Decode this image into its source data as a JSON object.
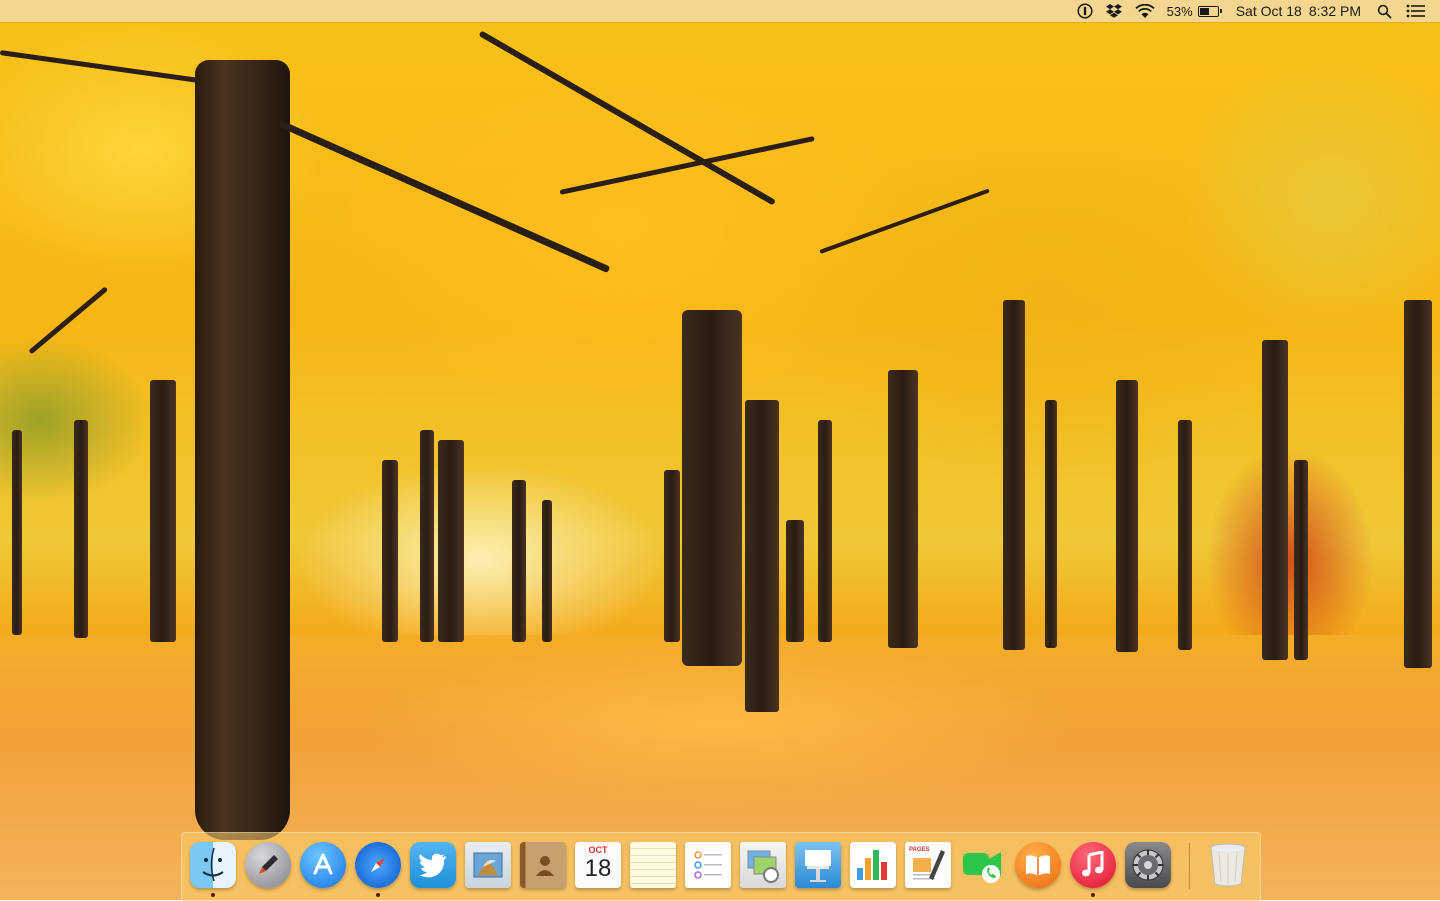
{
  "menubar": {
    "battery_percent": "53%",
    "battery_level": 0.53,
    "date": "Sat Oct 18",
    "time": "8:32 PM",
    "icons": [
      "onepassword-icon",
      "dropbox-icon",
      "wifi-icon",
      "battery-icon",
      "spotlight-icon",
      "notification-center-icon"
    ]
  },
  "dock": {
    "apps": [
      {
        "name": "Finder",
        "icon": "finder-icon",
        "running": true
      },
      {
        "name": "Launchpad",
        "icon": "launchpad-icon",
        "running": false
      },
      {
        "name": "App Store",
        "icon": "app-store-icon",
        "running": false
      },
      {
        "name": "Safari",
        "icon": "safari-icon",
        "running": true
      },
      {
        "name": "Twitter",
        "icon": "twitter-icon",
        "running": false
      },
      {
        "name": "Mail",
        "icon": "mail-icon",
        "running": false
      },
      {
        "name": "Contacts",
        "icon": "contacts-icon",
        "running": false
      },
      {
        "name": "Calendar",
        "icon": "calendar-icon",
        "running": false
      },
      {
        "name": "Notes",
        "icon": "notes-icon",
        "running": false
      },
      {
        "name": "Reminders",
        "icon": "reminders-icon",
        "running": false
      },
      {
        "name": "Preview",
        "icon": "preview-icon",
        "running": false
      },
      {
        "name": "Keynote",
        "icon": "keynote-icon",
        "running": false
      },
      {
        "name": "Numbers",
        "icon": "numbers-icon",
        "running": false
      },
      {
        "name": "Pages",
        "icon": "pages-icon",
        "running": false
      },
      {
        "name": "FaceTime",
        "icon": "facetime-icon",
        "running": false
      },
      {
        "name": "iBooks",
        "icon": "ibooks-icon",
        "running": false
      },
      {
        "name": "iTunes",
        "icon": "itunes-icon",
        "running": true
      },
      {
        "name": "System Preferences",
        "icon": "system-preferences-icon",
        "running": false
      },
      {
        "name": "Trash",
        "icon": "trash-icon",
        "running": false
      }
    ],
    "calendar_month": "OCT",
    "calendar_day": "18",
    "pages_label": "PAGES"
  },
  "colors": {
    "menubar_bg": "#f4d8a0",
    "dock_bg": "#facd6e",
    "running_dot": "#5a1a0a"
  }
}
